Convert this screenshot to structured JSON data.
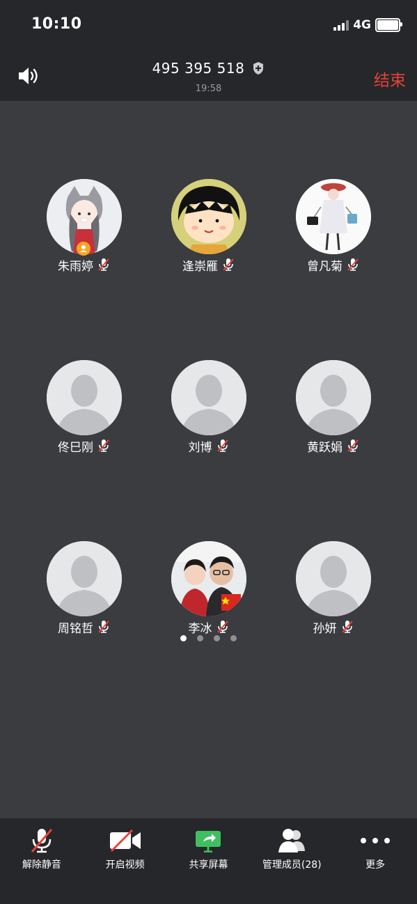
{
  "status_bar": {
    "time": "10:10",
    "network": "4G"
  },
  "header": {
    "meeting_id": "495 395 518",
    "duration": "19:58",
    "end_label": "结束"
  },
  "participants": [
    {
      "name": "朱雨婷",
      "avatar": "illustrated-girl-cat-hat",
      "host": true
    },
    {
      "name": "逢崇雁",
      "avatar": "cartoon-girl"
    },
    {
      "name": "曾凡菊",
      "avatar": "fashion-sketch"
    },
    {
      "name": "佟巳刚",
      "avatar": "default"
    },
    {
      "name": "刘博",
      "avatar": "default"
    },
    {
      "name": "黄跃娟",
      "avatar": "default"
    },
    {
      "name": "周铭哲",
      "avatar": "default"
    },
    {
      "name": "李冰",
      "avatar": "family-photo"
    },
    {
      "name": "孙妍",
      "avatar": "default"
    }
  ],
  "pagination": {
    "pages": 4,
    "current": 1
  },
  "toolbar": {
    "unmute": "解除静音",
    "start_video": "开启视频",
    "share_screen": "共享屏幕",
    "manage_members": "管理成员(28)",
    "more": "更多"
  },
  "colors": {
    "accent_red": "#e8423b",
    "share_green": "#3fbf5f",
    "host_orange": "#f5a623"
  }
}
